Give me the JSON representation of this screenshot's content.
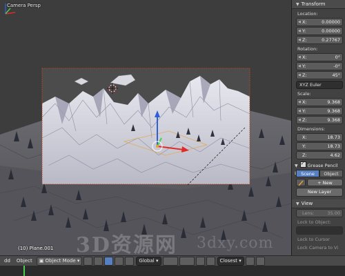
{
  "viewport": {
    "title": "Camera Persp",
    "object_label": "(10) Plane.001",
    "watermark": "3D资源网",
    "watermark2": "3dxy.com"
  },
  "panel": {
    "transform": {
      "header": "Transform",
      "location_label": "Location:",
      "location": [
        {
          "axis": "X:",
          "value": "0.00000"
        },
        {
          "axis": "Y:",
          "value": "0.00000"
        },
        {
          "axis": "Z:",
          "value": "0.27767"
        }
      ],
      "rotation_label": "Rotation:",
      "rotation": [
        {
          "axis": "X:",
          "value": "0°"
        },
        {
          "axis": "Y:",
          "value": "-0°"
        },
        {
          "axis": "Z:",
          "value": "45°"
        }
      ],
      "rotation_mode": "XYZ Euler",
      "scale_label": "Scale:",
      "scale": [
        {
          "axis": "X:",
          "value": "9.368"
        },
        {
          "axis": "Y:",
          "value": "9.368"
        },
        {
          "axis": "Z:",
          "value": "9.368"
        }
      ],
      "dimensions_label": "Dimensions:",
      "dimensions": [
        {
          "axis": "X:",
          "value": "18.73"
        },
        {
          "axis": "Y:",
          "value": "18.73"
        },
        {
          "axis": "Z:",
          "value": "4.62"
        }
      ]
    },
    "grease_pencil": {
      "header": "Grease Pencil La",
      "tab_scene": "Scene",
      "tab_object": "Object",
      "new_label": "New",
      "new_layer_label": "New Layer"
    },
    "view": {
      "header": "View",
      "lens_label": "Lens:",
      "lens_value": "35.00",
      "lock_to_object_label": "Lock to Object:",
      "lock_to_cursor_label": "Lock to Cursor",
      "lock_camera_label": "Lock Camera to Vi"
    }
  },
  "header_bar": {
    "add_label": "dd",
    "object_label": "Object",
    "mode_label": "Object Mode",
    "orientation_label": "Global",
    "snap_label": "Closest"
  },
  "colors": {
    "accent": "#5680c2",
    "selection_outline": "#e8a23a",
    "x_axis": "#e02a2a",
    "y_axis": "#4bd14b",
    "z_axis": "#2f5fd6"
  }
}
